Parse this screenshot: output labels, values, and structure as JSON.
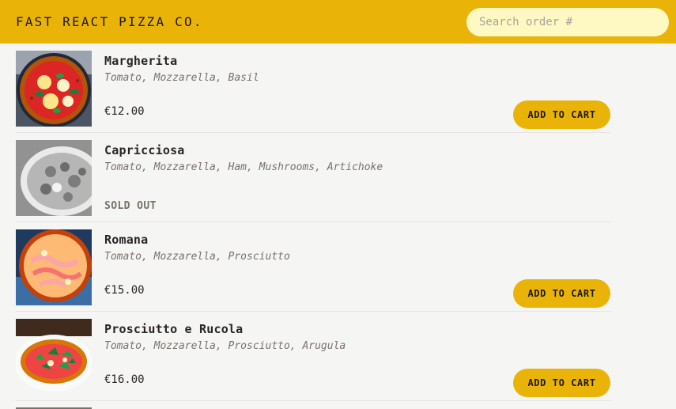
{
  "header": {
    "logo": "FAST REACT PIZZA CO.",
    "search_placeholder": "Search order #"
  },
  "menu": {
    "items": [
      {
        "name": "Margherita",
        "ingredients": "Tomato, Mozzarella, Basil",
        "price": "€12.00",
        "sold_out": false,
        "button_label": "ADD TO CART"
      },
      {
        "name": "Capricciosa",
        "ingredients": "Tomato, Mozzarella, Ham, Mushrooms, Artichoke",
        "status": "SOLD OUT",
        "sold_out": true
      },
      {
        "name": "Romana",
        "ingredients": "Tomato, Mozzarella, Prosciutto",
        "price": "€15.00",
        "sold_out": false,
        "button_label": "ADD TO CART"
      },
      {
        "name": "Prosciutto e Rucola",
        "ingredients": "Tomato, Mozzarella, Prosciutto, Arugula",
        "price": "€16.00",
        "sold_out": false,
        "button_label": "ADD TO CART"
      }
    ]
  },
  "colors": {
    "accent": "#eab308",
    "search_bg": "#fef9c3",
    "page_bg": "#f5f5f4",
    "divider": "#e7e5e4"
  }
}
